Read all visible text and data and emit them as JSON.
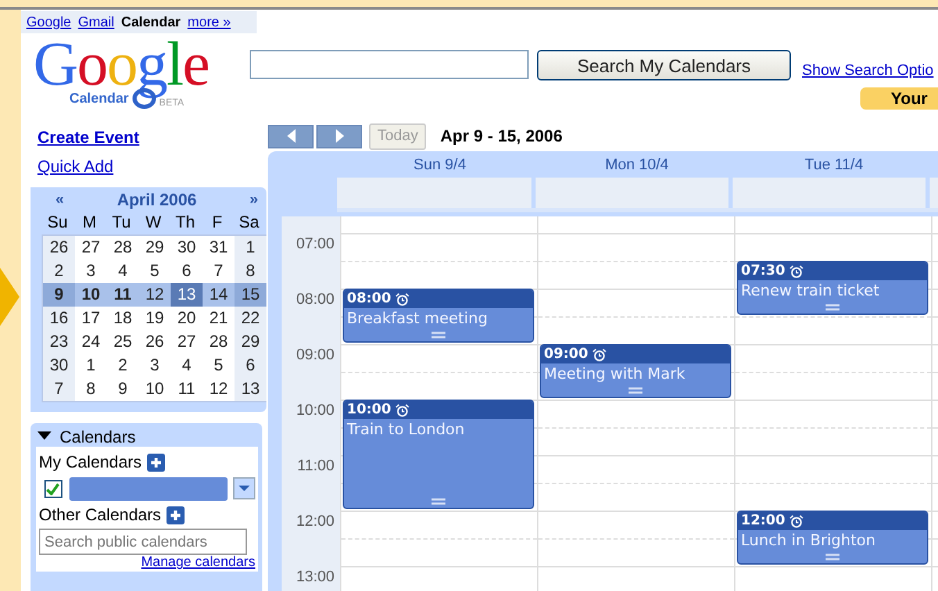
{
  "top_links": [
    {
      "label": "Google",
      "selected": false
    },
    {
      "label": "Gmail",
      "selected": false
    },
    {
      "label": "Calendar",
      "selected": true
    },
    {
      "label": "more »",
      "selected": false
    }
  ],
  "logo": {
    "word": "Google",
    "product": "Calendar",
    "badge": "BETA"
  },
  "search": {
    "button": "Search My Calendars",
    "options_link": "Show Search Optio"
  },
  "notice": "Your",
  "sidebar": {
    "create_event": "Create Event",
    "quick_add": "Quick Add"
  },
  "mini_calendar": {
    "prev": "«",
    "title": "April 2006",
    "next": "»",
    "weekdays": [
      "Su",
      "M",
      "Tu",
      "W",
      "Th",
      "F",
      "Sa"
    ],
    "weeks": [
      {
        "selected": false,
        "days": [
          {
            "label": "26",
            "today": false,
            "has_events": false
          },
          {
            "label": "27",
            "today": false,
            "has_events": false
          },
          {
            "label": "28",
            "today": false,
            "has_events": false
          },
          {
            "label": "29",
            "today": false,
            "has_events": false
          },
          {
            "label": "30",
            "today": false,
            "has_events": false
          },
          {
            "label": "31",
            "today": false,
            "has_events": false
          },
          {
            "label": "1",
            "today": false,
            "has_events": false
          }
        ]
      },
      {
        "selected": false,
        "days": [
          {
            "label": "2",
            "today": false,
            "has_events": false
          },
          {
            "label": "3",
            "today": false,
            "has_events": false
          },
          {
            "label": "4",
            "today": false,
            "has_events": false
          },
          {
            "label": "5",
            "today": false,
            "has_events": false
          },
          {
            "label": "6",
            "today": false,
            "has_events": false
          },
          {
            "label": "7",
            "today": false,
            "has_events": false
          },
          {
            "label": "8",
            "today": false,
            "has_events": false
          }
        ]
      },
      {
        "selected": true,
        "days": [
          {
            "label": "9",
            "today": false,
            "has_events": true
          },
          {
            "label": "10",
            "today": false,
            "has_events": true
          },
          {
            "label": "11",
            "today": false,
            "has_events": true
          },
          {
            "label": "12",
            "today": false,
            "has_events": false
          },
          {
            "label": "13",
            "today": true,
            "has_events": false
          },
          {
            "label": "14",
            "today": false,
            "has_events": false
          },
          {
            "label": "15",
            "today": false,
            "has_events": false
          }
        ]
      },
      {
        "selected": false,
        "days": [
          {
            "label": "16",
            "today": false,
            "has_events": false
          },
          {
            "label": "17",
            "today": false,
            "has_events": false
          },
          {
            "label": "18",
            "today": false,
            "has_events": false
          },
          {
            "label": "19",
            "today": false,
            "has_events": false
          },
          {
            "label": "20",
            "today": false,
            "has_events": false
          },
          {
            "label": "21",
            "today": false,
            "has_events": false
          },
          {
            "label": "22",
            "today": false,
            "has_events": false
          }
        ]
      },
      {
        "selected": false,
        "days": [
          {
            "label": "23",
            "today": false,
            "has_events": false
          },
          {
            "label": "24",
            "today": false,
            "has_events": false
          },
          {
            "label": "25",
            "today": false,
            "has_events": false
          },
          {
            "label": "26",
            "today": false,
            "has_events": false
          },
          {
            "label": "27",
            "today": false,
            "has_events": false
          },
          {
            "label": "28",
            "today": false,
            "has_events": false
          },
          {
            "label": "29",
            "today": false,
            "has_events": false
          }
        ]
      },
      {
        "selected": false,
        "days": [
          {
            "label": "30",
            "today": false,
            "has_events": false
          },
          {
            "label": "1",
            "today": false,
            "has_events": false
          },
          {
            "label": "2",
            "today": false,
            "has_events": false
          },
          {
            "label": "3",
            "today": false,
            "has_events": false
          },
          {
            "label": "4",
            "today": false,
            "has_events": false
          },
          {
            "label": "5",
            "today": false,
            "has_events": false
          },
          {
            "label": "6",
            "today": false,
            "has_events": false
          }
        ]
      },
      {
        "selected": false,
        "days": [
          {
            "label": "7",
            "today": false,
            "has_events": false
          },
          {
            "label": "8",
            "today": false,
            "has_events": false
          },
          {
            "label": "9",
            "today": false,
            "has_events": false
          },
          {
            "label": "10",
            "today": false,
            "has_events": false
          },
          {
            "label": "11",
            "today": false,
            "has_events": false
          },
          {
            "label": "12",
            "today": false,
            "has_events": false
          },
          {
            "label": "13",
            "today": false,
            "has_events": false
          }
        ]
      }
    ]
  },
  "calendars": {
    "title": "Calendars",
    "expanded": true,
    "my_label": "My Calendars",
    "my_calendars": [
      {
        "checked": true,
        "color": "#668cd9"
      }
    ],
    "other_label": "Other Calendars",
    "search_placeholder": "Search public calendars",
    "manage_link": "Manage calendars"
  },
  "nav": {
    "today": "Today",
    "range": "Apr 9 - 15, 2006"
  },
  "hours": [
    "07:00",
    "08:00",
    "09:00",
    "10:00",
    "11:00",
    "12:00",
    "13:00"
  ],
  "days": [
    {
      "label": "Sun 9/4",
      "events": [
        {
          "time": "08:00",
          "long": false,
          "title": "Breakfast meeting",
          "alarm": true
        },
        {
          "time": "10:00",
          "long": true,
          "title": "Train to London",
          "alarm": true
        }
      ]
    },
    {
      "label": "Mon 10/4",
      "events": [
        {
          "time": "09:00",
          "long": false,
          "title": "Meeting with Mark",
          "alarm": true
        }
      ]
    },
    {
      "label": "Tue 11/4",
      "events": [
        {
          "time": "07:30",
          "long": false,
          "title": "Renew train ticket",
          "alarm": true
        },
        {
          "time": "12:00",
          "long": false,
          "title": "Lunch in Brighton",
          "alarm": true
        }
      ]
    }
  ]
}
